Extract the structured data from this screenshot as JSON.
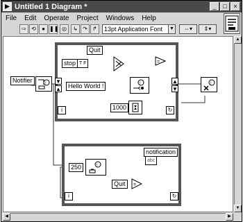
{
  "window": {
    "title": "Untitled 1 Diagram *"
  },
  "menu": [
    "File",
    "Edit",
    "Operate",
    "Project",
    "Windows",
    "Help"
  ],
  "toolbar": {
    "font": "13pt Application Font"
  },
  "diagram": {
    "notifier_label": "Notifier",
    "quit_label": "Quit",
    "stop_label": "stop",
    "stop_value": "T F",
    "hello_label": "Hello World !",
    "wait_value": "1000",
    "iteration_symbol": "i",
    "wait_value_2": "250",
    "notification_label": "notification",
    "notification_indicator": "abc",
    "quit_label_2": "Quit"
  }
}
